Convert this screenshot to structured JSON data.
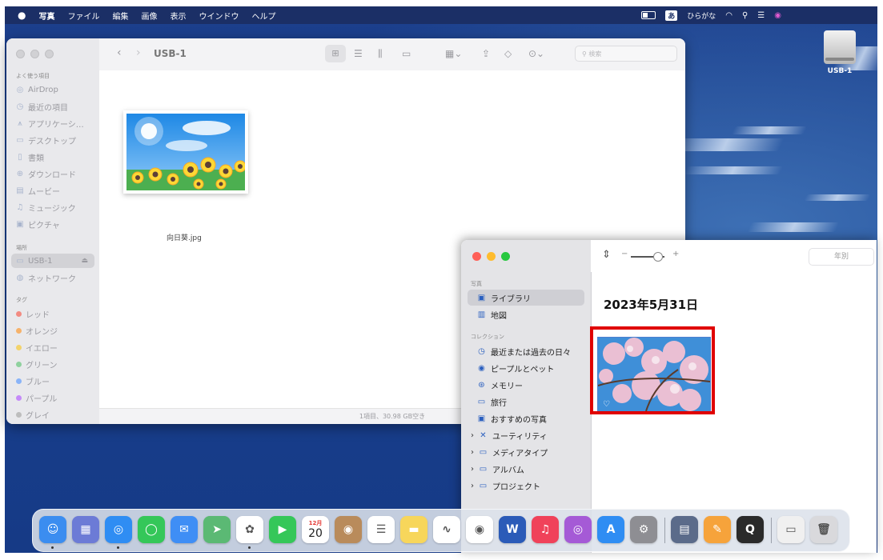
{
  "menubar": {
    "apple": "",
    "app": "写真",
    "items": [
      "ファイル",
      "編集",
      "画像",
      "表示",
      "ウインドウ",
      "ヘルプ"
    ],
    "ime_icon": "あ",
    "ime_label": "ひらがな"
  },
  "desktop": {
    "drive_label": "USB-1"
  },
  "finder": {
    "title": "USB-1",
    "search_placeholder": "検索",
    "sections": {
      "favorites": "よく使う項目",
      "locations": "場所",
      "tags": "タグ"
    },
    "favorites": [
      {
        "label": "AirDrop",
        "icon": "airdrop-icon",
        "glyph": "◎"
      },
      {
        "label": "最近の項目",
        "icon": "clock-icon",
        "glyph": "◷"
      },
      {
        "label": "アプリケーシ…",
        "icon": "apps-icon",
        "glyph": "⩚"
      },
      {
        "label": "デスクトップ",
        "icon": "desktop-icon",
        "glyph": "▭"
      },
      {
        "label": "書類",
        "icon": "document-icon",
        "glyph": "▯"
      },
      {
        "label": "ダウンロード",
        "icon": "download-icon",
        "glyph": "⊕"
      },
      {
        "label": "ムービー",
        "icon": "movie-icon",
        "glyph": "▤"
      },
      {
        "label": "ミュージック",
        "icon": "music-icon",
        "glyph": "♫"
      },
      {
        "label": "ピクチャ",
        "icon": "picture-icon",
        "glyph": "▣"
      }
    ],
    "locations": [
      {
        "label": "USB-1",
        "icon": "drive-icon",
        "glyph": "▭"
      },
      {
        "label": "ネットワーク",
        "icon": "network-icon",
        "glyph": "◍"
      }
    ],
    "tags": [
      {
        "label": "レッド",
        "color": "#f28b82"
      },
      {
        "label": "オレンジ",
        "color": "#f6b26b"
      },
      {
        "label": "イエロー",
        "color": "#f3d36b"
      },
      {
        "label": "グリーン",
        "color": "#8fd19e"
      },
      {
        "label": "ブルー",
        "color": "#8ab4f8"
      },
      {
        "label": "パープル",
        "color": "#c58af9"
      },
      {
        "label": "グレイ",
        "color": "#bdbdbd"
      }
    ],
    "file_name": "向日葵.jpg",
    "status": "1項目、30.98 GB空き"
  },
  "photos": {
    "sections": {
      "photos": "写真",
      "collections": "コレクション"
    },
    "library": [
      {
        "label": "ライブラリ",
        "icon": "library-icon",
        "glyph": "▣"
      },
      {
        "label": "地図",
        "icon": "map-icon",
        "glyph": "▥"
      }
    ],
    "collections": [
      {
        "label": "最近または過去の日々",
        "icon": "clock-icon",
        "glyph": "◷"
      },
      {
        "label": "ピープルとペット",
        "icon": "person-icon",
        "glyph": "◉"
      },
      {
        "label": "メモリー",
        "icon": "memories-icon",
        "glyph": "⊛"
      },
      {
        "label": "旅行",
        "icon": "suitcase-icon",
        "glyph": "▭"
      },
      {
        "label": "おすすめの写真",
        "icon": "featured-icon",
        "glyph": "▣"
      }
    ],
    "groups": [
      {
        "label": "ユーティリティ",
        "icon": "utilities-icon",
        "glyph": "✕"
      },
      {
        "label": "メディアタイプ",
        "icon": "folder-icon",
        "glyph": "▭"
      },
      {
        "label": "アルバム",
        "icon": "folder-icon",
        "glyph": "▭"
      },
      {
        "label": "プロジェクト",
        "icon": "folder-icon",
        "glyph": "▭"
      }
    ],
    "slider_minus": "−",
    "slider_plus": "+",
    "view_segment": "年別",
    "date_heading": "2023年5月31日"
  },
  "dock": {
    "calendar_month": "12月",
    "calendar_day": "20",
    "word_letter": "W",
    "apps": [
      {
        "name": "finder",
        "color": "#3b8df0",
        "glyph": "☺"
      },
      {
        "name": "launchpad",
        "color": "#6c7bd6",
        "glyph": "▦"
      },
      {
        "name": "safari",
        "color": "#2f8df3",
        "glyph": "◎"
      },
      {
        "name": "messages",
        "color": "#34c759",
        "glyph": "◯"
      },
      {
        "name": "mail",
        "color": "#3f8ef5",
        "glyph": "✉"
      },
      {
        "name": "maps",
        "color": "#5bb974",
        "glyph": "➤"
      },
      {
        "name": "photos",
        "color": "#ffffff",
        "glyph": "✿"
      },
      {
        "name": "facetime",
        "color": "#35c759",
        "glyph": "▶"
      },
      {
        "name": "calendar",
        "color": "#ffffff",
        "glyph": ""
      },
      {
        "name": "contacts",
        "color": "#b98b5b",
        "glyph": "◉"
      },
      {
        "name": "reminders",
        "color": "#ffffff",
        "glyph": "☰"
      },
      {
        "name": "notes",
        "color": "#f7d65b",
        "glyph": "▬"
      },
      {
        "name": "freeform",
        "color": "#ffffff",
        "glyph": "∿"
      },
      {
        "name": "chrome",
        "color": "#ffffff",
        "glyph": "◉"
      },
      {
        "name": "word",
        "color": "#2b5bb8",
        "glyph": ""
      },
      {
        "name": "music",
        "color": "#f0425a",
        "glyph": "♫"
      },
      {
        "name": "podcasts",
        "color": "#a55ad6",
        "glyph": "◎"
      },
      {
        "name": "app-store",
        "color": "#2f8df3",
        "glyph": "A"
      },
      {
        "name": "system-settings",
        "color": "#8e8e93",
        "glyph": "⚙"
      },
      {
        "name": "preview",
        "color": "#5b6b8a",
        "glyph": "▤"
      },
      {
        "name": "pages",
        "color": "#f6a33b",
        "glyph": "✎"
      },
      {
        "name": "quicktime",
        "color": "#2a2a2a",
        "glyph": "Q"
      },
      {
        "name": "downloads-stack",
        "color": "#f0f0f0",
        "glyph": "▭"
      },
      {
        "name": "trash",
        "color": "#d9d9dc",
        "glyph": "🗑"
      }
    ]
  }
}
